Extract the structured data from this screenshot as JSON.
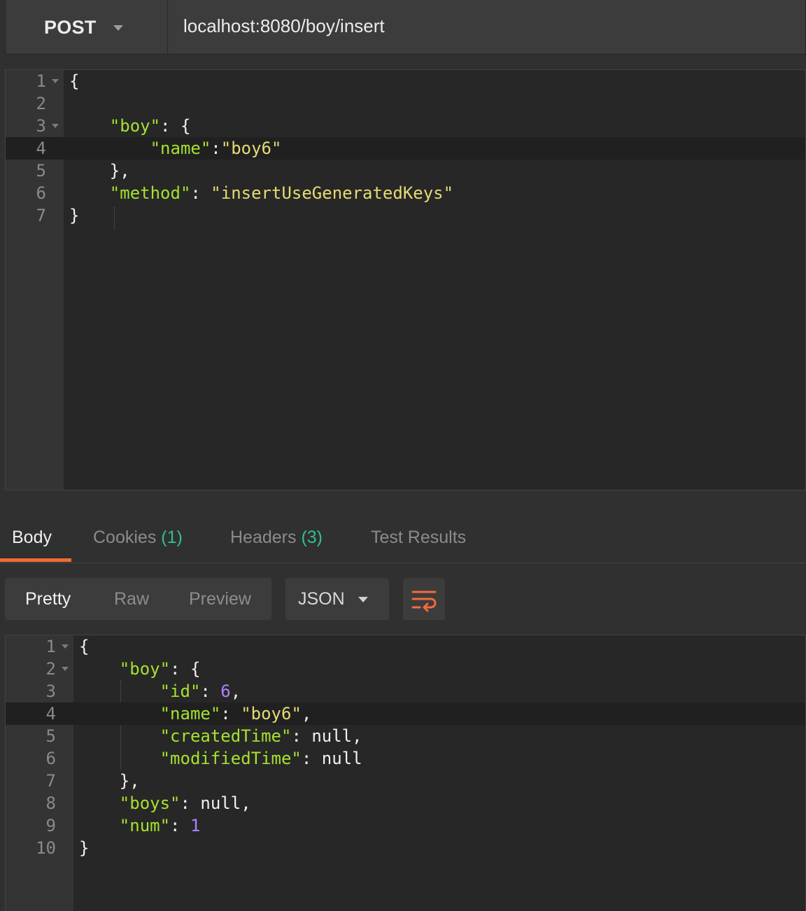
{
  "request": {
    "method": "POST",
    "url": "localhost:8080/boy/insert"
  },
  "request_body": {
    "lines": [
      {
        "num": "1",
        "fold": true
      },
      {
        "num": "2",
        "fold": false
      },
      {
        "num": "3",
        "fold": true
      },
      {
        "num": "4",
        "fold": false,
        "active": true
      },
      {
        "num": "5",
        "fold": false
      },
      {
        "num": "6",
        "fold": false
      },
      {
        "num": "7",
        "fold": false
      }
    ],
    "text": {
      "l1_brace": "{",
      "l3_key": "\"boy\"",
      "l3_rest": ": {",
      "l4_key": "\"name\"",
      "l4_colon": ":",
      "l4_value": "\"boy6\"",
      "l5": "},",
      "l6_key": "\"method\"",
      "l6_colon": ": ",
      "l6_value": "\"insertUseGeneratedKeys\"",
      "l7_brace": "}"
    }
  },
  "response_tabs": [
    {
      "label": "Body",
      "count": "",
      "active": true
    },
    {
      "label": "Cookies ",
      "count": "(1)"
    },
    {
      "label": "Headers ",
      "count": "(3)"
    },
    {
      "label": "Test Results",
      "count": ""
    }
  ],
  "format_modes": [
    "Pretty",
    "Raw",
    "Preview"
  ],
  "active_format": "Pretty",
  "language": "JSON",
  "wrap_icon": "wrap-lines-icon",
  "response_body": {
    "line_numbers": [
      "1",
      "2",
      "3",
      "4",
      "5",
      "6",
      "7",
      "8",
      "9",
      "10"
    ],
    "text": {
      "l1": "{",
      "l2_key": "\"boy\"",
      "l2_rest": ": {",
      "l3_key": "\"id\"",
      "l3_colon": ": ",
      "l3_value": "6",
      "l3_comma": ",",
      "l4_key": "\"name\"",
      "l4_colon": ": ",
      "l4_value": "\"boy6\"",
      "l4_comma": ",",
      "l5_key": "\"createdTime\"",
      "l5_rest": ": null,",
      "l6_key": "\"modifiedTime\"",
      "l6_rest": ": null",
      "l7": "},",
      "l8_key": "\"boys\"",
      "l8_rest": ": null,",
      "l9_key": "\"num\"",
      "l9_colon": ": ",
      "l9_value": "1",
      "l10": "}"
    }
  },
  "colors": {
    "background": "#303030",
    "editor_bg": "#272727",
    "gutter_bg": "#343434",
    "json_key": "#a6e22e",
    "json_string": "#e6db74",
    "json_number": "#ae81ff",
    "tab_accent": "#f26b3a",
    "count_badge": "#2fbf8f"
  }
}
